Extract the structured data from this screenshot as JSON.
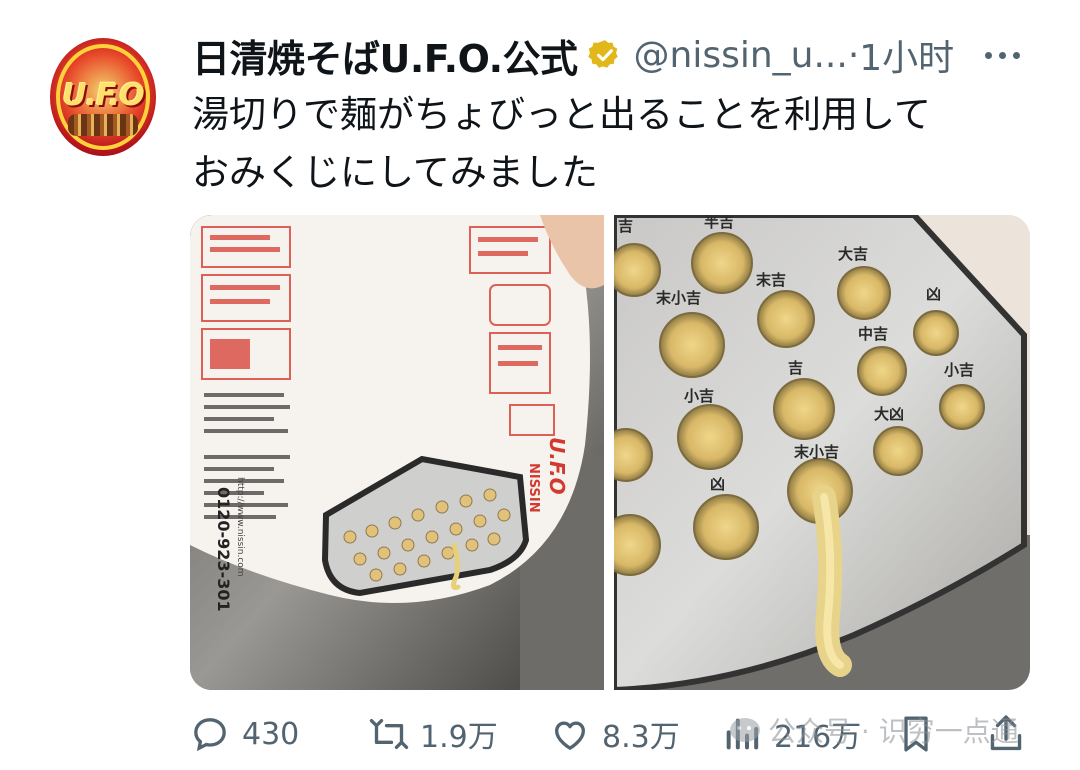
{
  "tweet": {
    "display_name": "日清焼そばU.F.O.公式",
    "handle": "@nissin_u...",
    "separator": "·",
    "time": "1小时",
    "text_lines": [
      "湯切りで麺がちょびっと出ることを利用して",
      "おみくじにしてみました"
    ]
  },
  "avatar": {
    "logo_text": "U.F.O"
  },
  "media": {
    "left_photo": {
      "phone": "0120-923-301",
      "url": "http://www.nissin.com",
      "brand": "NISSIN",
      "product": "U.F.O"
    },
    "right_photo": {
      "hole_labels": [
        "吉",
        "半吉",
        "末小吉",
        "末吉",
        "大吉",
        "凶",
        "中吉",
        "小吉",
        "吉",
        "小吉",
        "大凶",
        "末小吉",
        "凶"
      ]
    }
  },
  "actions": {
    "reply_count": "430",
    "retweet_count": "1.9万",
    "like_count": "8.3万",
    "view_count": "216万"
  },
  "watermark": {
    "text": "公众号 · 识穷一点通"
  },
  "colors": {
    "verified_gold": "#e2b719",
    "text_primary": "#0f1419",
    "text_secondary": "#536471"
  }
}
